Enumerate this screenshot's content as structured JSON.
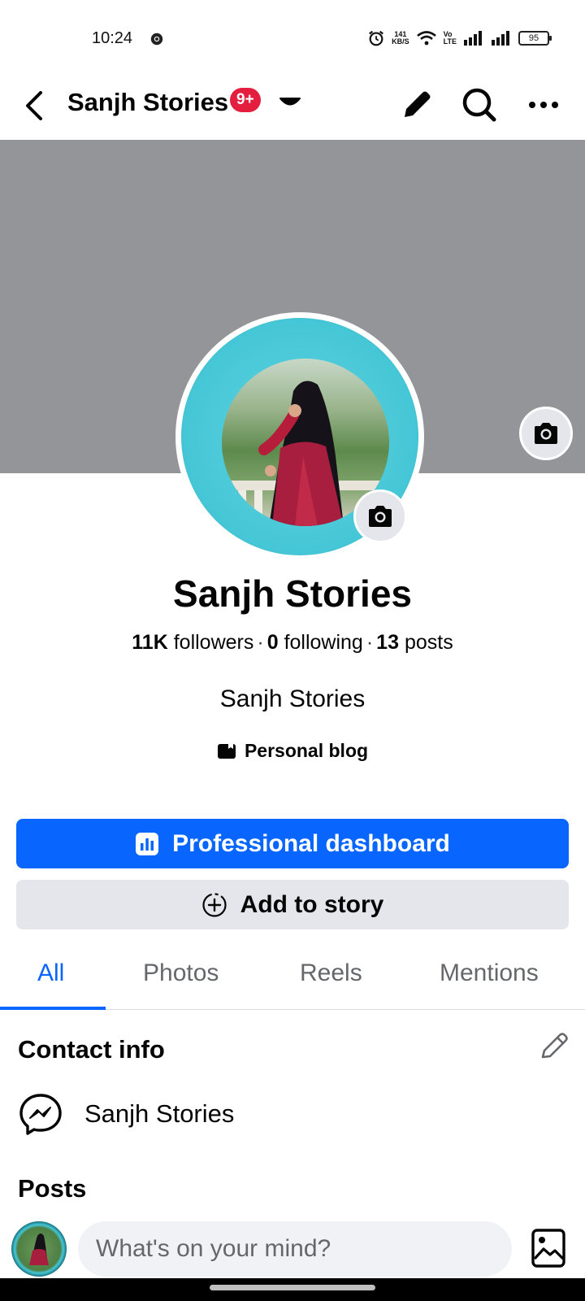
{
  "status_bar": {
    "time": "10:24",
    "net_speed_value": "141",
    "net_speed_unit": "KB/S",
    "volte_top": "Vo",
    "volte_bottom": "LTE",
    "battery": "95"
  },
  "header": {
    "title": "Sanjh Stories",
    "badge": "9+"
  },
  "profile": {
    "name": "Sanjh Stories",
    "followers_count": "11K",
    "followers_label": "followers",
    "following_count": "0",
    "following_label": "following",
    "posts_count": "13",
    "posts_label": "posts",
    "bio": "Sanjh Stories",
    "category": "Personal blog"
  },
  "actions": {
    "dashboard_label": "Professional dashboard",
    "story_label": "Add to story"
  },
  "tabs": [
    {
      "label": "All",
      "active": true
    },
    {
      "label": "Photos",
      "active": false
    },
    {
      "label": "Reels",
      "active": false
    },
    {
      "label": "Mentions",
      "active": false
    }
  ],
  "contact": {
    "title": "Contact info",
    "messenger_name": "Sanjh Stories"
  },
  "posts": {
    "title": "Posts",
    "composer_placeholder": "What's on your mind?"
  },
  "colors": {
    "brand_blue": "#0866ff",
    "badge_red": "#e41e3f",
    "cover_gray": "#939598",
    "secondary_button": "#e4e6eb"
  },
  "icons": [
    "chrome-icon",
    "alarm-icon",
    "wifi-icon",
    "signal-icon",
    "back-arrow-icon",
    "caret-down-icon",
    "pencil-icon",
    "search-icon",
    "more-icon",
    "camera-icon",
    "bar-chart-icon",
    "add-circle-icon",
    "messenger-icon",
    "photo-icon"
  ]
}
